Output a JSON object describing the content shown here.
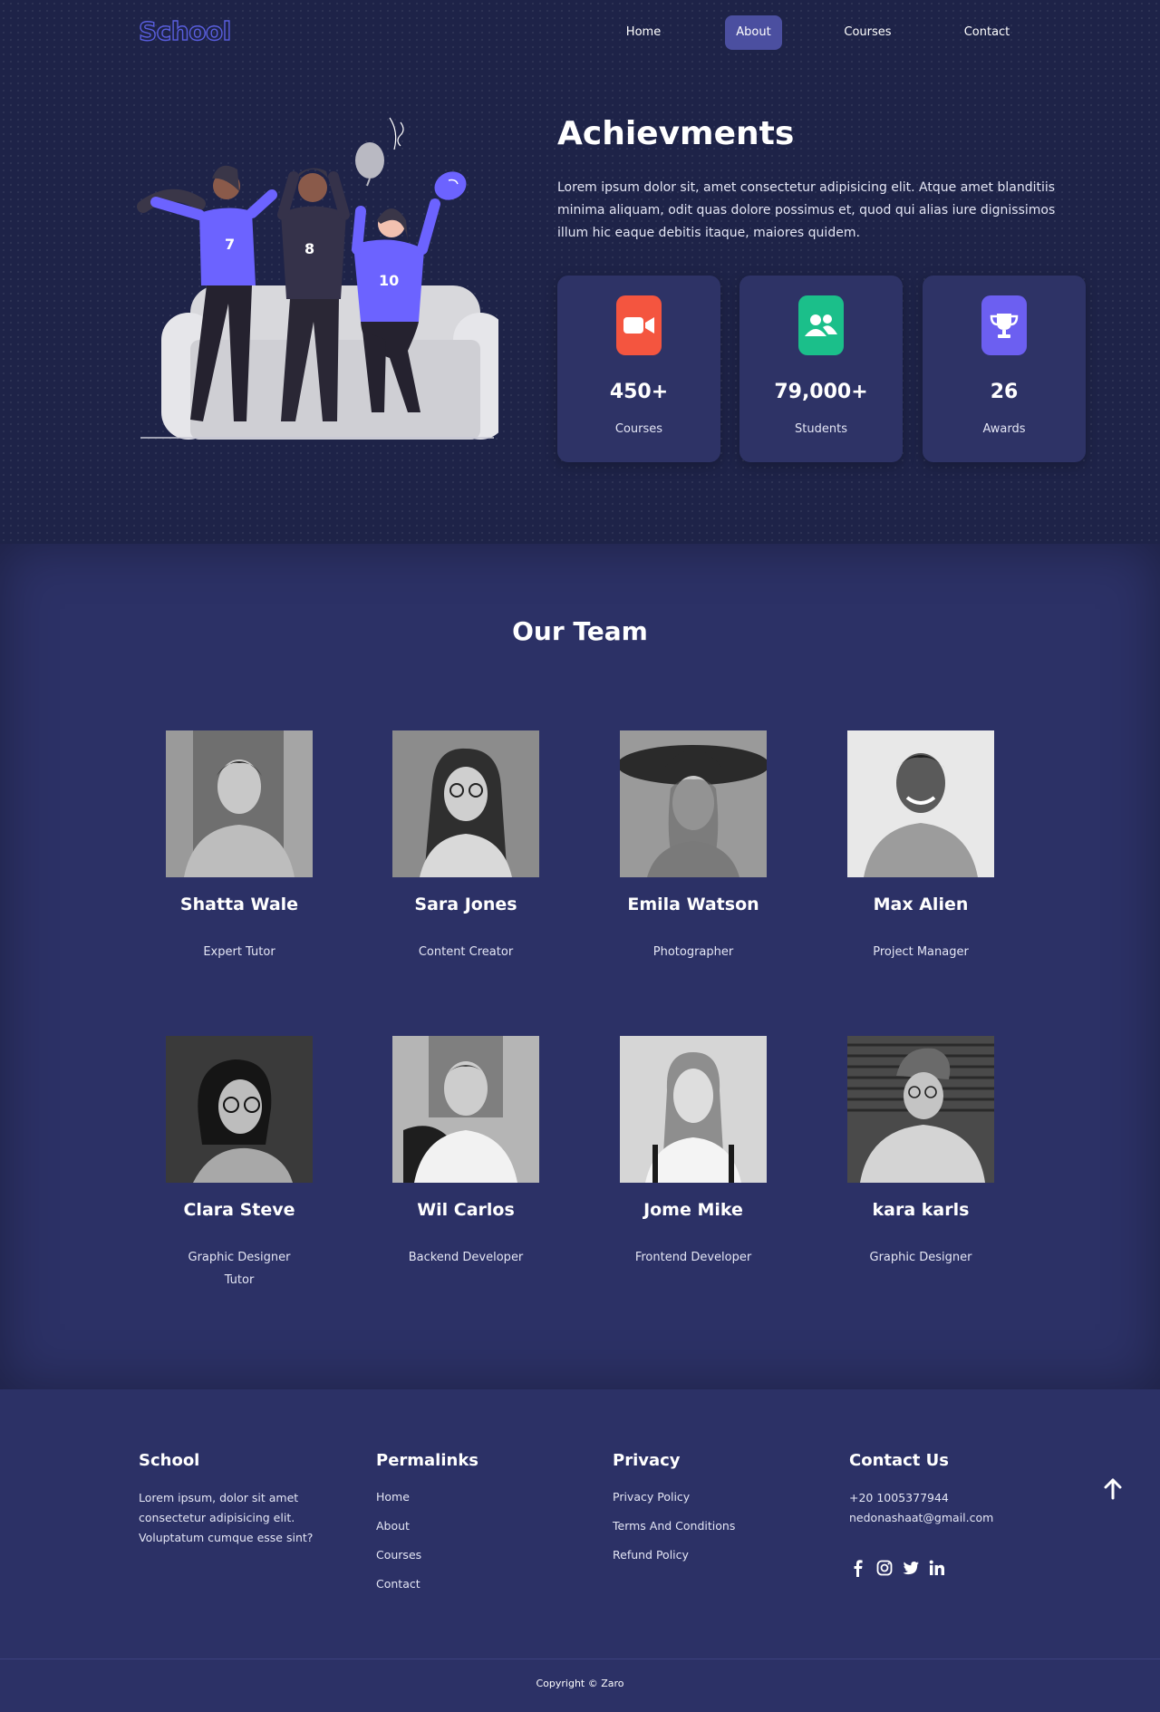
{
  "nav": {
    "logo": "School",
    "links": [
      "Home",
      "About",
      "Courses",
      "Contact"
    ],
    "active": "About"
  },
  "hero": {
    "illustration_numbers": [
      "7",
      "8",
      "10"
    ],
    "title": "Achievments",
    "text": "Lorem ipsum dolor sit, amet consectetur adipisicing elit. Atque amet blanditiis minima aliquam, odit quas dolore possimus et, quod qui alias iure dignissimos illum hic eaque debitis itaque, maiores quidem.",
    "stats": [
      {
        "icon": "video-camera-icon",
        "color": "#f4553f",
        "value": "450+",
        "label": "Courses"
      },
      {
        "icon": "users-icon",
        "color": "#1bbf8a",
        "value": "79,000+",
        "label": "Students"
      },
      {
        "icon": "trophy-icon",
        "color": "#6c5ff1",
        "value": "26",
        "label": "Awards"
      }
    ]
  },
  "team": {
    "title": "Our Team",
    "members": [
      {
        "name": "Shatta Wale",
        "role": "Expert Tutor"
      },
      {
        "name": "Sara Jones",
        "role": "Content Creator"
      },
      {
        "name": "Emila Watson",
        "role": "Photographer"
      },
      {
        "name": "Max Alien",
        "role": "Project Manager"
      },
      {
        "name": "Clara Steve",
        "role": "Graphic Designer Tutor"
      },
      {
        "name": "Wil Carlos",
        "role": "Backend Developer"
      },
      {
        "name": "Jome Mike",
        "role": "Frontend Developer"
      },
      {
        "name": "kara karls",
        "role": "Graphic Designer"
      }
    ]
  },
  "footer": {
    "school": {
      "heading": "School",
      "text": "Lorem ipsum, dolor sit amet consectetur adipisicing elit. Voluptatum cumque esse sint?"
    },
    "permalinks": {
      "heading": "Permalinks",
      "links": [
        "Home",
        "About",
        "Courses",
        "Contact"
      ]
    },
    "privacy": {
      "heading": "Privacy",
      "links": [
        "Privacy Policy",
        "Terms And Conditions",
        "Refund Policy"
      ]
    },
    "contact": {
      "heading": "Contact Us",
      "phone": "+20 1005377944",
      "email": "nedonashaat@gmail.com"
    },
    "socials": [
      "facebook-icon",
      "instagram-icon",
      "twitter-icon",
      "linkedin-icon"
    ],
    "copyright": "Copyright © Zaro"
  },
  "colors": {
    "accent": "#5a5fe0",
    "hero_bg": "#1e2348",
    "section_bg": "#2c3166",
    "card_bg": "#2e3366"
  }
}
